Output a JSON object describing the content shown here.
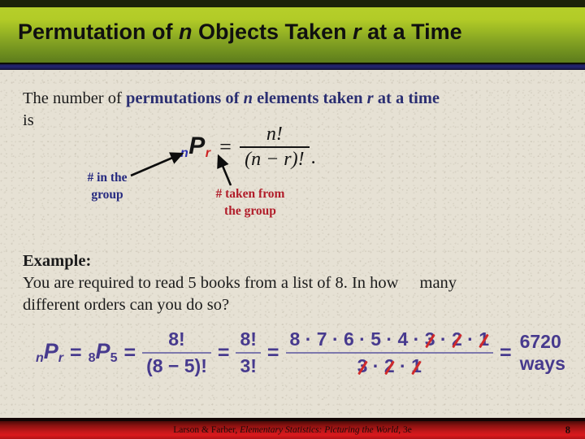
{
  "slide": {
    "title_prefix": "Permutation of ",
    "title_var1": "n",
    "title_mid": " Objects Taken ",
    "title_var2": "r",
    "title_suffix": " at a Time",
    "accent_banner_top": "#b6cf2a",
    "accent_banner_bottom": "#5d7c1c",
    "accent_rule": "#232470",
    "accent_footer": "#c2171a",
    "background": "#e6e1d4"
  },
  "lead": {
    "part_plain_1": "The number of ",
    "part_bold_1": "permutations of ",
    "part_bold_var_n": "n",
    "part_bold_2": " elements taken ",
    "part_bold_var_r": "r",
    "part_bold_3": "  at a time",
    "part_plain_2": "is",
    "highlight_color": "#2b2f72"
  },
  "formula": {
    "base_symbol": "P",
    "sub_left": "n",
    "sub_right": "r",
    "equals": "=",
    "numerator": "n!",
    "denominator": "(n − r)!",
    "trailing_period": ".",
    "sub_left_color": "#2b2fb0",
    "sub_right_color": "#cc2222"
  },
  "annotations": {
    "blue_label_line1": "# in the",
    "blue_label_line2": "group",
    "blue_color": "#262a80",
    "red_label_line1": "# taken from",
    "red_label_line2": "the group",
    "red_color": "#b11d2a"
  },
  "example": {
    "heading": "Example:",
    "line1_a": "You are required to read 5 books from a list of 8. In how",
    "line1_b": "many",
    "line2": "different orders can you do so?"
  },
  "solution": {
    "color": "#473a8e",
    "cancel_color": "#d02a2a",
    "sym_p": "P",
    "sub_n": "n",
    "sub_r": "r",
    "eq1": "=",
    "sub_8": "8",
    "sub_5": "5",
    "eq2": "=",
    "frac1_num": "8!",
    "frac1_den": "(8 − 5)!",
    "eq3": "=",
    "frac2_num": "8!",
    "frac2_den": "3!",
    "eq4": "=",
    "expand_num_keep": "8 · 7 · 6 · 5 · 4 · ",
    "expand_num_c1": "3",
    "expand_num_s1": " · ",
    "expand_num_c2": "2",
    "expand_num_s2": " · ",
    "expand_num_c3": "1",
    "expand_den_c1": "3",
    "expand_den_s1": " · ",
    "expand_den_c2": "2",
    "expand_den_s2": " · ",
    "expand_den_c3": "1",
    "eq5": "=",
    "result": "6720 ways"
  },
  "footer": {
    "authors": "Larson & Farber, ",
    "book_title": "Elementary Statistics: Picturing the World",
    "edition": ", 3e",
    "page_number": "8"
  }
}
